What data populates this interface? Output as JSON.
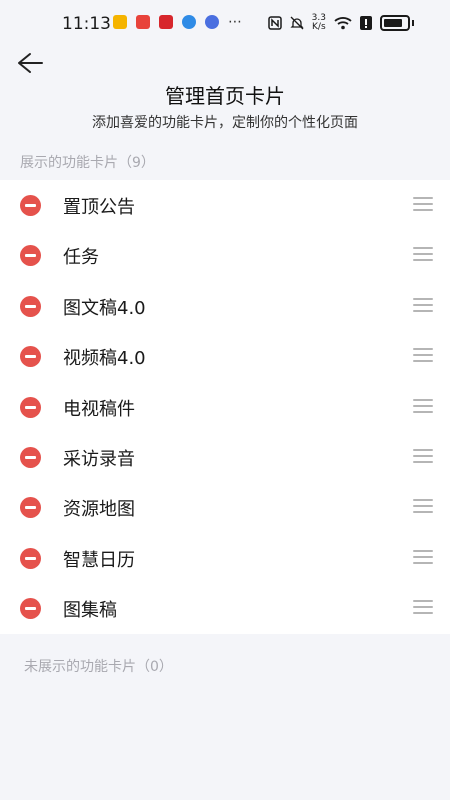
{
  "status_bar": {
    "time": "11:13",
    "net_speed_value": "3.3",
    "net_speed_unit": "K/s",
    "app_icons": [
      {
        "name": "notification-app-icon",
        "color": "#f5b400"
      },
      {
        "name": "notification-app-icon",
        "color": "#e8433b"
      },
      {
        "name": "notification-app-icon",
        "color": "#d7262c"
      },
      {
        "name": "notification-app-icon",
        "color": "#2f8be6"
      },
      {
        "name": "notification-app-icon",
        "color": "#4a6fe0"
      }
    ],
    "more_icon": "⋯"
  },
  "header": {
    "back_icon": "arrow-left-icon",
    "title": "管理首页卡片",
    "subtitle": "添加喜爱的功能卡片，定制你的个性化页面"
  },
  "shown_section": {
    "label": "展示的功能卡片（9）",
    "items": [
      {
        "label": "置顶公告"
      },
      {
        "label": "任务"
      },
      {
        "label": "图文稿4.0"
      },
      {
        "label": "视频稿4.0"
      },
      {
        "label": "电视稿件"
      },
      {
        "label": "采访录音"
      },
      {
        "label": "资源地图"
      },
      {
        "label": "智慧日历"
      },
      {
        "label": "图集稿"
      }
    ]
  },
  "hidden_section": {
    "label": "未展示的功能卡片（0）"
  },
  "colors": {
    "background": "#f4f5f9",
    "card_background": "#ffffff",
    "remove_red": "#e5524c",
    "section_label": "#a9a9b0"
  }
}
